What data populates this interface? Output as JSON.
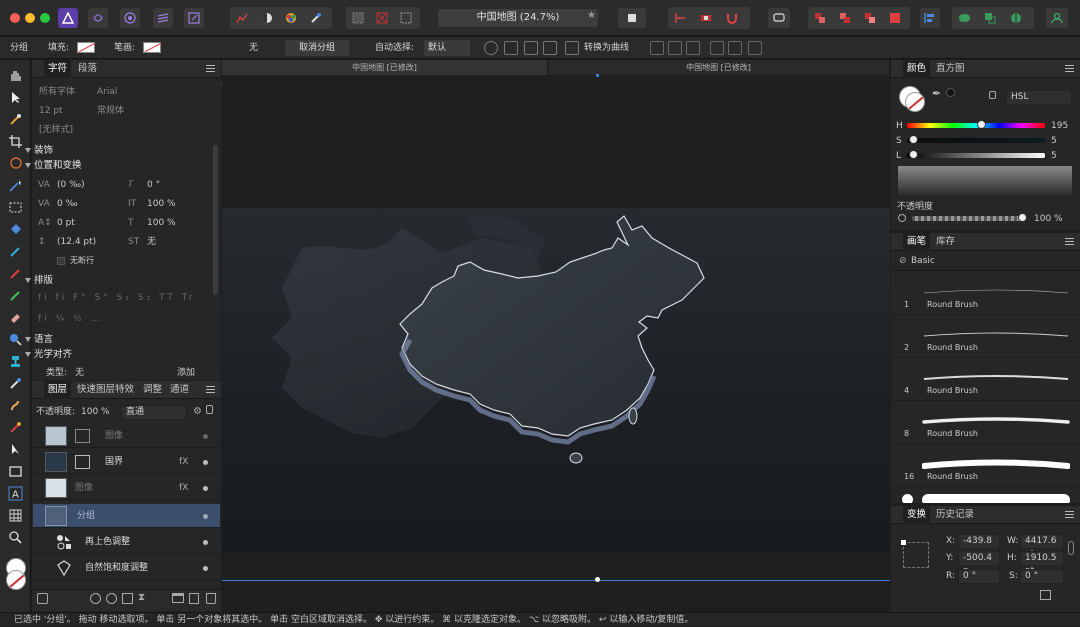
{
  "window": {
    "title": "中国地图 (24.7%)"
  },
  "context_toolbar": {
    "group_label": "分组",
    "fill_label": "填充:",
    "stroke_label": "笔画:",
    "stroke_value": "无",
    "ungroup_button": "取消分组",
    "auto_select_label": "自动选择:",
    "auto_select_value": "默认",
    "convert_to_curves": "转换为曲线"
  },
  "character_panel": {
    "tabs": [
      "字符",
      "段落"
    ],
    "font_collection": "所有字体",
    "font_family": "Arial",
    "font_size": "12 pt",
    "font_style": "常规体",
    "style": "[无样式]",
    "sections": {
      "decoration": "装饰",
      "position_transform": "位置和变换",
      "typography": "排版",
      "language": "语言",
      "optical_alignment": "光学对齐"
    },
    "fields": {
      "tracking": "(0 ‰)",
      "shear": "0 °",
      "kerning": "0 ‰",
      "v_scale": "100 %",
      "baseline": "0 pt",
      "h_scale": "100 %",
      "leading": "(12.4 pt)",
      "caps": "无"
    },
    "no_break": "无断行",
    "type_label": "类型:",
    "type_value": "无",
    "add_button": "添加"
  },
  "layers_panel": {
    "tabs": [
      "图层",
      "快速图层特效",
      "调整",
      "通道"
    ],
    "opacity_label": "不透明度:",
    "opacity_value": "100 %",
    "blend_mode": "直通",
    "layers": [
      {
        "name": "图像"
      },
      {
        "name": "国界"
      },
      {
        "name": "图像"
      },
      {
        "name": "分组"
      },
      {
        "name": "再上色调整"
      },
      {
        "name": "自然饱和度调整"
      }
    ]
  },
  "canvas": {
    "tabs": [
      "中国地图 [已修改]",
      "中国地图 [已修改]"
    ]
  },
  "color_panel": {
    "tabs": [
      "颜色",
      "直方图"
    ],
    "model": "HSL",
    "h": {
      "label": "H",
      "value": "195",
      "fraction": 0.54
    },
    "s": {
      "label": "S",
      "value": "5",
      "fraction": 0.05
    },
    "l": {
      "label": "L",
      "value": "5",
      "fraction": 0.05
    },
    "opacity_label": "不透明度",
    "opacity_value": "100 %"
  },
  "brushes_panel": {
    "tabs": [
      "画笔",
      "库存"
    ],
    "category": "Basic",
    "brushes": [
      {
        "size": "1",
        "name": "Round Brush"
      },
      {
        "size": "2",
        "name": "Round Brush"
      },
      {
        "size": "4",
        "name": "Round Brush"
      },
      {
        "size": "8",
        "name": "Round Brush"
      },
      {
        "size": "16",
        "name": "Round Brush"
      }
    ]
  },
  "transform_panel": {
    "tabs": [
      "变换",
      "历史记录"
    ],
    "x_label": "X:",
    "x": "-439.8 p",
    "y_label": "Y:",
    "y": "-500.4 p",
    "w_label": "W:",
    "w": "4417.6 pt",
    "h_label": "H:",
    "h": "1910.5 pt",
    "r_label": "R:",
    "r": "0 °",
    "s_label": "S:",
    "s": "0 °"
  },
  "status": "已选中 '分组'。 拖动 移动选取项。 单击 另一个对象将其选中。 单击 空白区域取消选择。 ✥ 以进行约束。 ⌘ 以克隆选定对象。 ⌥ 以忽略吸附。 ↩ 以输入移动/复制值。"
}
